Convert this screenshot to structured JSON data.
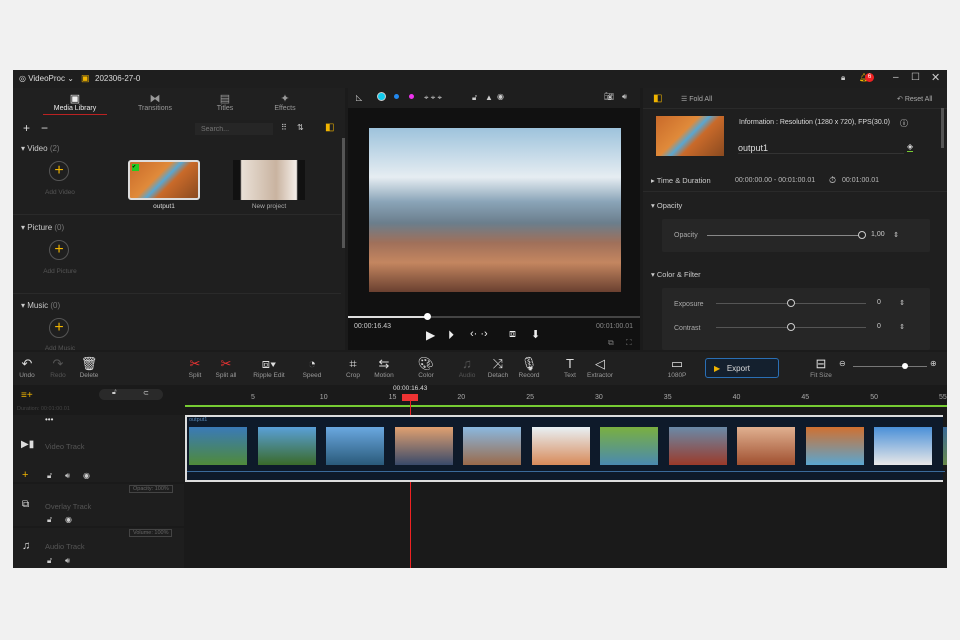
{
  "app": {
    "name": "VideoProc",
    "project": "202306-27-0",
    "notifications": "6"
  },
  "library": {
    "tabs": [
      {
        "label": "Media Library"
      },
      {
        "label": "Transitions"
      },
      {
        "label": "Titles"
      },
      {
        "label": "Effects"
      }
    ],
    "search_placeholder": "Search...",
    "sections": [
      {
        "label": "Video",
        "count": "(2)",
        "add": "Add Video"
      },
      {
        "label": "Picture",
        "count": "(0)",
        "add": "Add Picture"
      },
      {
        "label": "Music",
        "count": "(0)",
        "add": "Add Music"
      }
    ],
    "videos": [
      {
        "name": "output1"
      },
      {
        "name": "New project"
      }
    ]
  },
  "preview": {
    "current_time": "00:00:16.43",
    "total_time": "00:01:00.01",
    "progress": 0.27
  },
  "inspector": {
    "fold_all": "Fold All",
    "reset_all": "Reset All",
    "info": "Information : Resolution (1280 x 720), FPS(30.0)",
    "clip_name": "output1",
    "time_section": "Time & Duration",
    "time_range": "00:00:00.00 - 00:01:00.01",
    "duration": "00:01:00.01",
    "opacity_section": "Opacity",
    "opacity_label": "Opacity",
    "opacity_value": "1,00",
    "color_section": "Color & Filter",
    "exposure_label": "Exposure",
    "exposure_value": "0",
    "contrast_label": "Contrast",
    "contrast_value": "0"
  },
  "toolbar": {
    "undo": "Undo",
    "redo": "Redo",
    "delete": "Delete",
    "split": "Split",
    "split_all": "Split all",
    "ripple": "Ripple Edit",
    "speed": "Speed",
    "crop": "Crop",
    "motion": "Motion",
    "color": "Color",
    "audio": "Audio",
    "detach": "Detach",
    "record": "Record",
    "text": "Text",
    "extractor": "Extractor",
    "resolution": "1080P",
    "export": "Export",
    "fit": "Fit Size",
    "zoom_level": 0.7
  },
  "timeline": {
    "playhead": "00:00:16.43",
    "duration_label": "Duration:",
    "duration": "00:01:00.01",
    "ticks": [
      "5",
      "10",
      "15",
      "20",
      "25",
      "30",
      "35",
      "40",
      "45",
      "50",
      "55"
    ],
    "clip_label": "output1",
    "tracks": [
      {
        "name": "Video Track"
      },
      {
        "name": "Overlay Track",
        "badge": "Opacity: 100%"
      },
      {
        "name": "Audio Track",
        "badge": "Volume: 100%"
      }
    ]
  }
}
